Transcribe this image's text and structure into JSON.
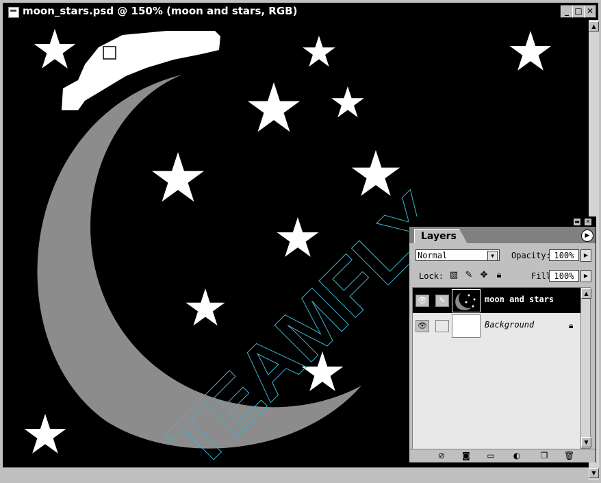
{
  "window": {
    "title": "moon_stars.psd @ 150% (moon and stars, RGB)",
    "buttons": {
      "minimize": "_",
      "maximize": "□",
      "close": "✕"
    }
  },
  "canvas": {
    "background_color": "#000000",
    "moon_color": "#8c8c8c",
    "star_color": "#ffffff",
    "watermark": "TEAMFLY"
  },
  "layers_panel": {
    "tab_label": "Layers",
    "blend_mode": "Normal",
    "opacity_label": "Opacity:",
    "opacity_value": "100%",
    "lock_label": "Lock:",
    "fill_label": "Fill:",
    "fill_value": "100%",
    "lock_icons": [
      "lock-transparency-icon",
      "lock-image-icon",
      "lock-position-icon",
      "lock-all-icon"
    ],
    "layers": [
      {
        "name": "moon and stars",
        "selected": true,
        "visible": true
      },
      {
        "name": "Background",
        "selected": false,
        "visible": true,
        "locked": true
      }
    ],
    "bottom_icons": [
      "layer-style-icon",
      "layer-mask-icon",
      "new-set-icon",
      "adjustment-layer-icon",
      "new-layer-icon",
      "trash-icon"
    ]
  }
}
